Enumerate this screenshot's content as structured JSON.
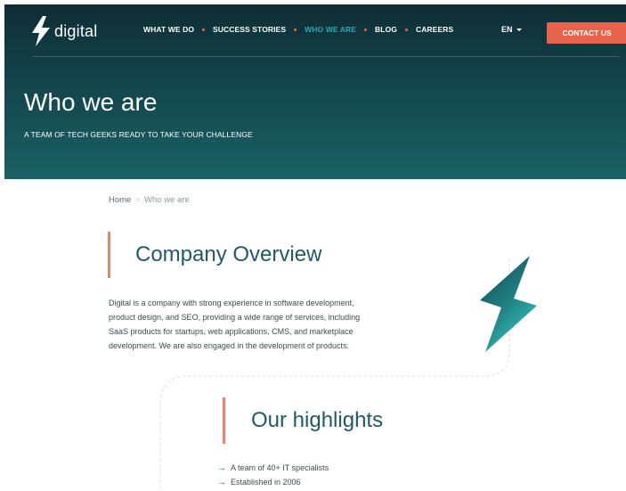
{
  "brand": {
    "logo_text": "digital",
    "accent_color": "#e8634c",
    "teal_color": "#1f5a66"
  },
  "nav": {
    "items": [
      {
        "label": "WHAT WE DO",
        "active": false
      },
      {
        "label": "SUCCESS STORIES",
        "active": false
      },
      {
        "label": "WHO WE ARE",
        "active": true
      },
      {
        "label": "BLOG",
        "active": false
      },
      {
        "label": "CAREERS",
        "active": false
      }
    ],
    "language": "EN",
    "contact_label": "CONTACT US"
  },
  "hero": {
    "title": "Who we are",
    "subtitle": "A TEAM OF TECH GEEKS READY TO TAKE YOUR CHALLENGE"
  },
  "breadcrumb": {
    "home": "Home",
    "separator": ">",
    "current": "Who we are"
  },
  "overview": {
    "title": "Company Overview",
    "lines": [
      "Digital is a company with strong experience in software development,",
      "product design, and SEO, providing a wide range of services, including",
      "SaaS products for startups, web applications, CMS, and marketplace",
      "development. We are also engaged in the development of products."
    ]
  },
  "highlights": {
    "title": "Our highlights",
    "items": [
      "A team of 40+ IT specialists",
      "Established in 2006"
    ]
  },
  "icons": {
    "logo": "lightning-bolt-icon",
    "decorative": "lightning-bolt-icon",
    "lang_caret": "caret-down-icon",
    "list_bullet": "arrow-right-icon"
  }
}
